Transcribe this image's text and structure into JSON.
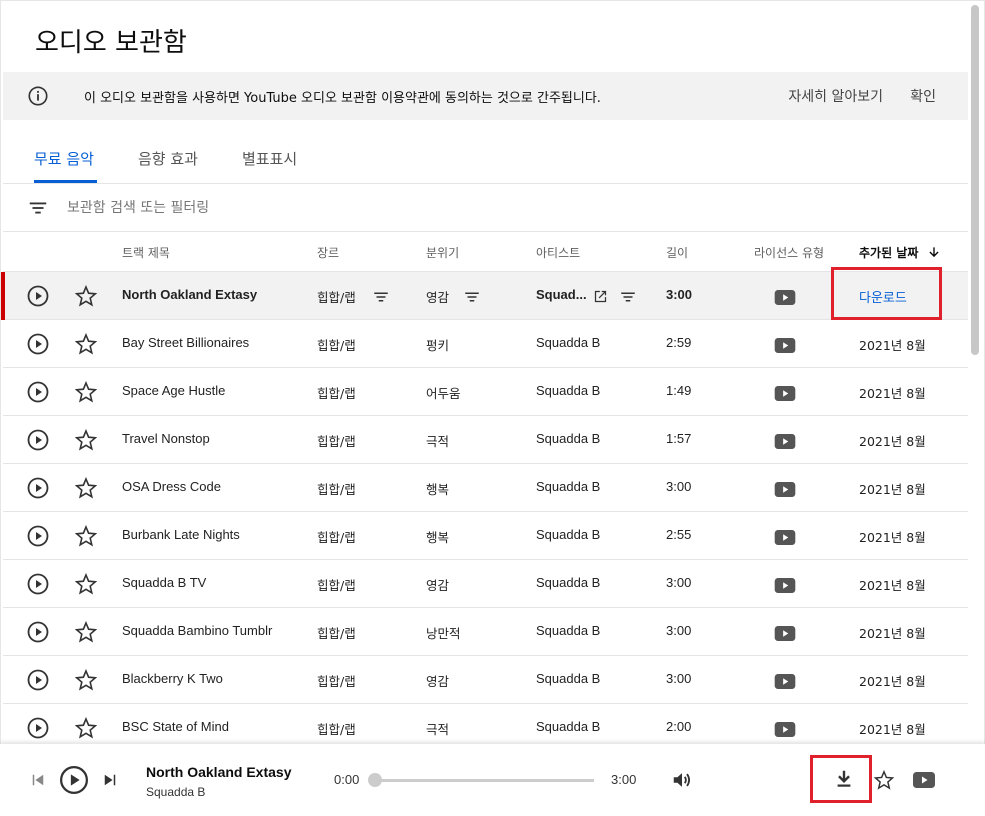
{
  "page": {
    "title": "오디오 보관함"
  },
  "notice": {
    "text": "이 오디오 보관함을 사용하면 YouTube 오디오 보관함 이용약관에 동의하는 것으로 간주됩니다.",
    "learn_more": "자세히 알아보기",
    "confirm": "확인"
  },
  "tabs": [
    {
      "label": "무료 음악",
      "active": true
    },
    {
      "label": "음향 효과",
      "active": false
    },
    {
      "label": "별표표시",
      "active": false
    }
  ],
  "search": {
    "placeholder": "보관함 검색 또는 필터링"
  },
  "table": {
    "headers": {
      "title": "트랙 제목",
      "genre": "장르",
      "mood": "분위기",
      "artist": "아티스트",
      "length": "길이",
      "license": "라이선스 유형",
      "date": "추가된 날짜"
    },
    "rows": [
      {
        "title": "North Oakland Extasy",
        "genre": "힙합/랩",
        "mood": "영감",
        "artist": "Squad...",
        "length": "3:00",
        "date": "다운로드",
        "selected": true
      },
      {
        "title": "Bay Street Billionaires",
        "genre": "힙합/랩",
        "mood": "펑키",
        "artist": "Squadda B",
        "length": "2:59",
        "date": "2021년 8월"
      },
      {
        "title": "Space Age Hustle",
        "genre": "힙합/랩",
        "mood": "어두움",
        "artist": "Squadda B",
        "length": "1:49",
        "date": "2021년 8월"
      },
      {
        "title": "Travel Nonstop",
        "genre": "힙합/랩",
        "mood": "극적",
        "artist": "Squadda B",
        "length": "1:57",
        "date": "2021년 8월"
      },
      {
        "title": "OSA Dress Code",
        "genre": "힙합/랩",
        "mood": "행복",
        "artist": "Squadda B",
        "length": "3:00",
        "date": "2021년 8월"
      },
      {
        "title": "Burbank Late Nights",
        "genre": "힙합/랩",
        "mood": "행복",
        "artist": "Squadda B",
        "length": "2:55",
        "date": "2021년 8월"
      },
      {
        "title": "Squadda B TV",
        "genre": "힙합/랩",
        "mood": "영감",
        "artist": "Squadda B",
        "length": "3:00",
        "date": "2021년 8월"
      },
      {
        "title": "Squadda Bambino Tumblr",
        "genre": "힙합/랩",
        "mood": "낭만적",
        "artist": "Squadda B",
        "length": "3:00",
        "date": "2021년 8월"
      },
      {
        "title": "Blackberry K Two",
        "genre": "힙합/랩",
        "mood": "영감",
        "artist": "Squadda B",
        "length": "3:00",
        "date": "2021년 8월"
      },
      {
        "title": "BSC State of Mind",
        "genre": "힙합/랩",
        "mood": "극적",
        "artist": "Squadda B",
        "length": "2:00",
        "date": "2021년 8월"
      }
    ]
  },
  "player": {
    "title": "North Oakland Extasy",
    "artist": "Squadda B",
    "current_time": "0:00",
    "total_time": "3:00",
    "progress": 0
  },
  "colors": {
    "accent": "#065fd4",
    "highlight": "#e0202b",
    "selected_marker": "#cc0000"
  }
}
